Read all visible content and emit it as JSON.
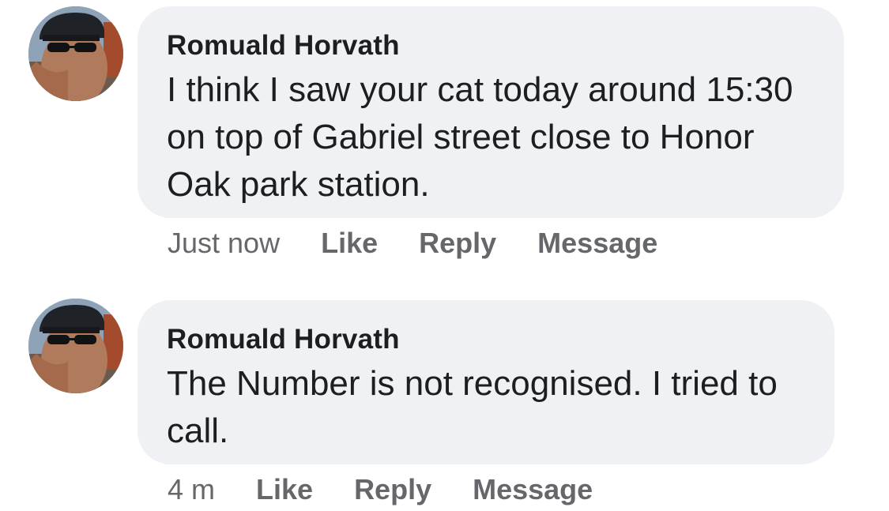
{
  "comments": [
    {
      "author": "Romuald Horvath",
      "text": "I think I saw your cat today around 15:30 on top of Gabriel street close to Honor Oak park station.",
      "time": "Just now",
      "like": "Like",
      "reply": "Reply",
      "message": "Message"
    },
    {
      "author": "Romuald Horvath",
      "text": "The Number is not recognised. I tried to call.",
      "time": "4 m",
      "like": "Like",
      "reply": "Reply",
      "message": "Message"
    }
  ],
  "avatar_icon": "profile-photo-man-cap-sunglasses"
}
